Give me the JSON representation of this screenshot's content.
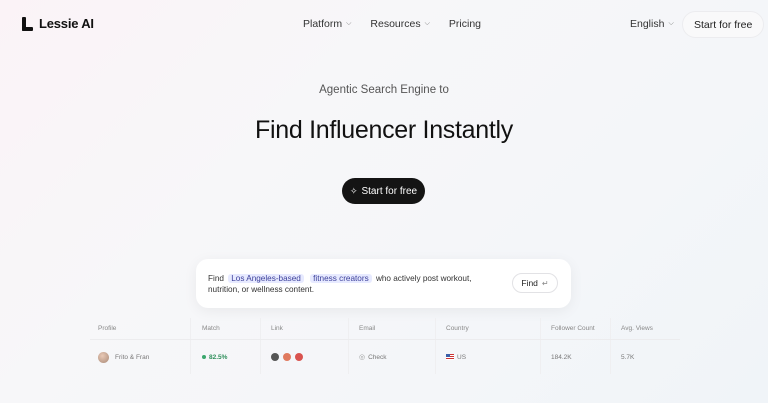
{
  "nav": {
    "brand": "Lessie AI",
    "menu": [
      {
        "label": "Platform",
        "has_dropdown": true
      },
      {
        "label": "Resources",
        "has_dropdown": true
      },
      {
        "label": "Pricing",
        "has_dropdown": false
      }
    ],
    "language": "English",
    "cta": "Start for free"
  },
  "hero": {
    "subtitle": "Agentic Search Engine to",
    "headline": "Find Influencer Instantly",
    "cta": "Start for free"
  },
  "search": {
    "prefix": "Find",
    "tag1": "Los Angeles-based",
    "tag2": "fitness creators",
    "suffix": "who actively post workout, nutrition, or wellness content.",
    "button": "Find"
  },
  "table": {
    "headers": [
      "Profile",
      "Match",
      "Link",
      "Email",
      "Country",
      "Follower Count",
      "Avg. Views"
    ],
    "rows": [
      {
        "profile": "Frito & Fran",
        "match": "82.5%",
        "email": "Check",
        "country": "US",
        "followers": "184.2K",
        "avg_views": "5.7K"
      }
    ]
  },
  "colors": {
    "cta_bg": "#141414",
    "tag_bg": "#e7eaff",
    "match_green": "#2f8f5b"
  }
}
